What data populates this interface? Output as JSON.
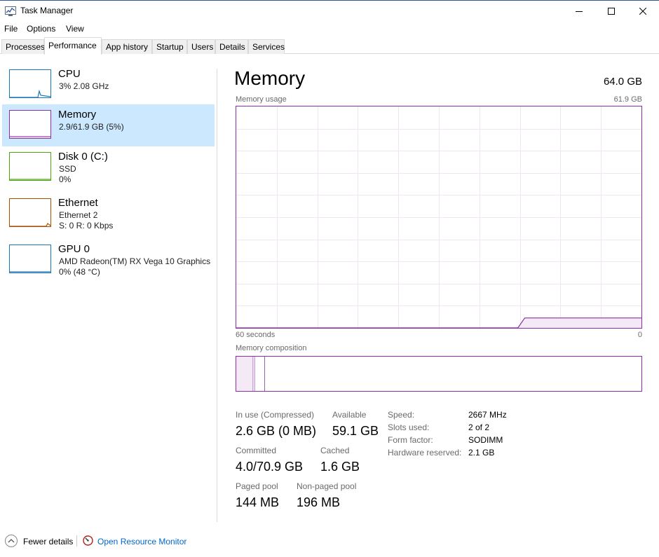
{
  "window": {
    "title": "Task Manager",
    "accent_color": "#8b2da8"
  },
  "menu": [
    "File",
    "Options",
    "View"
  ],
  "tabs": [
    "Processes",
    "Performance",
    "App history",
    "Startup",
    "Users",
    "Details",
    "Services"
  ],
  "active_tab": "Performance",
  "sidebar": {
    "items": [
      {
        "name": "CPU",
        "line1": "3%  2.08 GHz",
        "line2": "",
        "color": "#1a75b8",
        "level": 0.03
      },
      {
        "name": "Memory",
        "line1": "2.9/61.9 GB (5%)",
        "line2": "",
        "color": "#8b2da8",
        "level": 0.05,
        "selected": true
      },
      {
        "name": "Disk 0 (C:)",
        "line1": "SSD",
        "line2": "0%",
        "color": "#4da60c",
        "level": 0
      },
      {
        "name": "Ethernet",
        "line1": "Ethernet 2",
        "line2": "S: 0  R: 0 Kbps",
        "color": "#a74f01",
        "level": 0.02
      },
      {
        "name": "GPU 0",
        "line1": "AMD Radeon(TM) RX Vega 10 Graphics",
        "line2": "0%  (48 °C)",
        "color": "#1a75b8",
        "level": 0
      }
    ]
  },
  "main": {
    "title": "Memory",
    "total": "64.0 GB",
    "usage_label": "Memory usage",
    "usage_max": "61.9 GB",
    "time_left": "60 seconds",
    "time_right": "0",
    "composition_label": "Memory composition",
    "usage_history_fraction": [
      0,
      0,
      0,
      0,
      0,
      0,
      0,
      0,
      0,
      0,
      0,
      0,
      0,
      0,
      0,
      0,
      0,
      0,
      0,
      0,
      0,
      0,
      0,
      0,
      0,
      0,
      0,
      0,
      0,
      0,
      0,
      0,
      0,
      0,
      0,
      0,
      0,
      0,
      0,
      0,
      0,
      0,
      0.045,
      0.045,
      0.045,
      0.045,
      0.045,
      0.045,
      0.045,
      0.045,
      0.045,
      0.045,
      0.045,
      0.045,
      0.045,
      0.045,
      0.045,
      0.045,
      0.045,
      0.045
    ]
  },
  "stats": {
    "in_use_label": "In use (Compressed)",
    "in_use_value": "2.6 GB (0 MB)",
    "available_label": "Available",
    "available_value": "59.1 GB",
    "committed_label": "Committed",
    "committed_value": "4.0/70.9 GB",
    "cached_label": "Cached",
    "cached_value": "1.6 GB",
    "paged_label": "Paged pool",
    "paged_value": "144 MB",
    "nonpaged_label": "Non-paged pool",
    "nonpaged_value": "196 MB"
  },
  "specs": [
    {
      "label": "Speed:",
      "value": "2667 MHz"
    },
    {
      "label": "Slots used:",
      "value": "2 of 2"
    },
    {
      "label": "Form factor:",
      "value": "SODIMM"
    },
    {
      "label": "Hardware reserved:",
      "value": "2.1 GB"
    }
  ],
  "footer": {
    "fewer_details": "Fewer details",
    "resource_monitor": "Open Resource Monitor"
  }
}
